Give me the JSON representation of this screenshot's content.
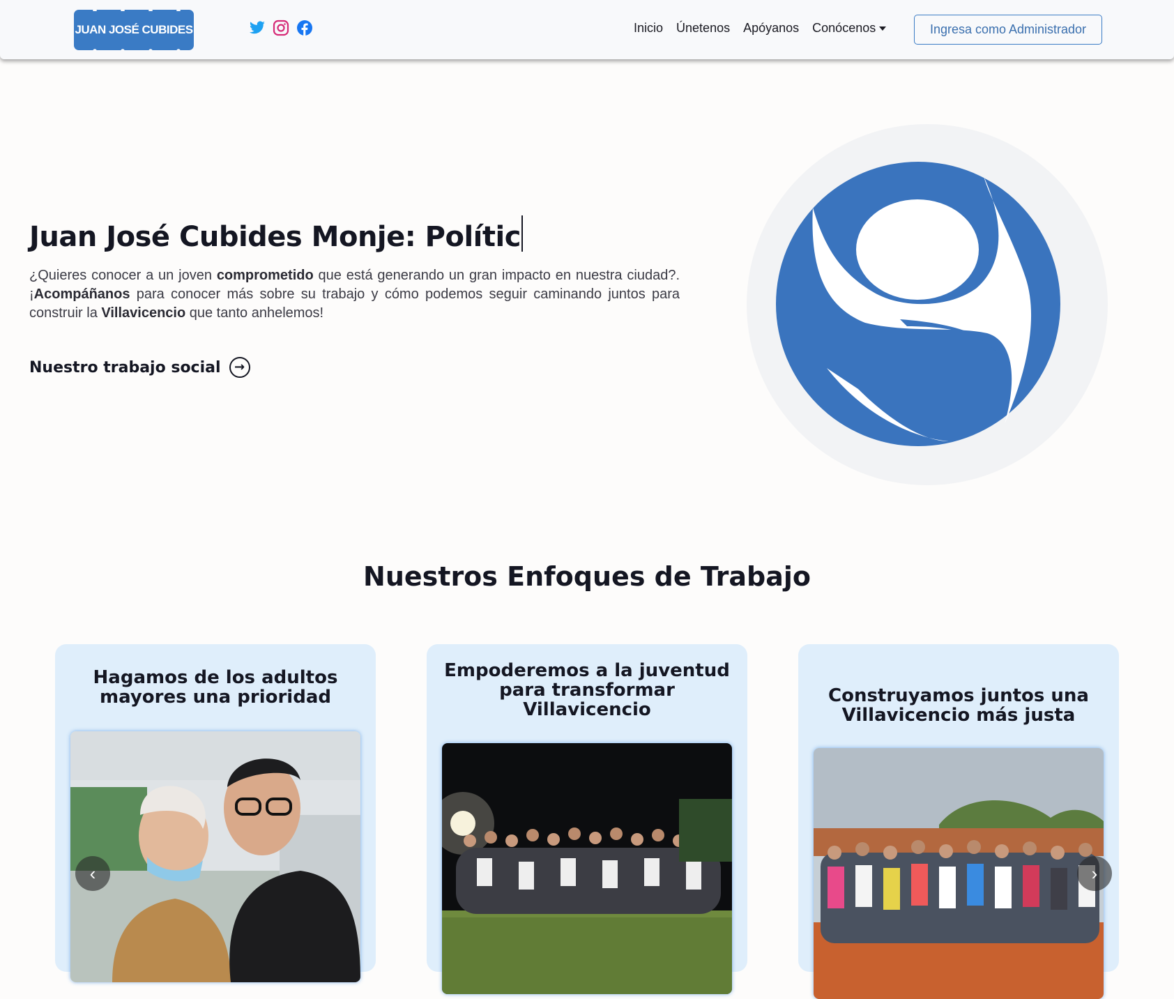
{
  "nav": {
    "brand": "JUAN JOSÉ CUBIDES",
    "social": [
      {
        "icon": "twitter-icon",
        "color": "#1da1f2"
      },
      {
        "icon": "instagram-icon",
        "color": "#d62976"
      },
      {
        "icon": "facebook-icon",
        "color": "#1877f2"
      }
    ],
    "links": [
      "Inicio",
      "Únetenos",
      "Apóyanos",
      "Conócenos"
    ],
    "admin_button": "Ingresa como Administrador"
  },
  "hero": {
    "title": "Juan José Cubides Monje: Polític",
    "text_1": "¿Quieres conocer a un joven ",
    "bold_1": "comprometido",
    "text_2": " que está generando un gran impacto en nuestra ciudad?. ¡",
    "bold_2": "Acompáñanos",
    "text_3": " para conocer más sobre su trabajo y cómo podemos seguir caminando juntos para construir la ",
    "bold_3": "Villavicencio",
    "text_4": " que tanto anhelemos!",
    "link": "Nuestro trabajo social"
  },
  "section": {
    "title": "Nuestros Enfoques de Trabajo",
    "cards": [
      {
        "title": "Hagamos de los adultos mayores una prioridad"
      },
      {
        "title": "Empoderemos a la juventud para transformar Villavicencio"
      },
      {
        "title": "Construyamos juntos una Villavicencio más justa"
      }
    ]
  },
  "colors": {
    "brand_blue": "#3a7bc5",
    "card_bg": "#dfeefb"
  }
}
